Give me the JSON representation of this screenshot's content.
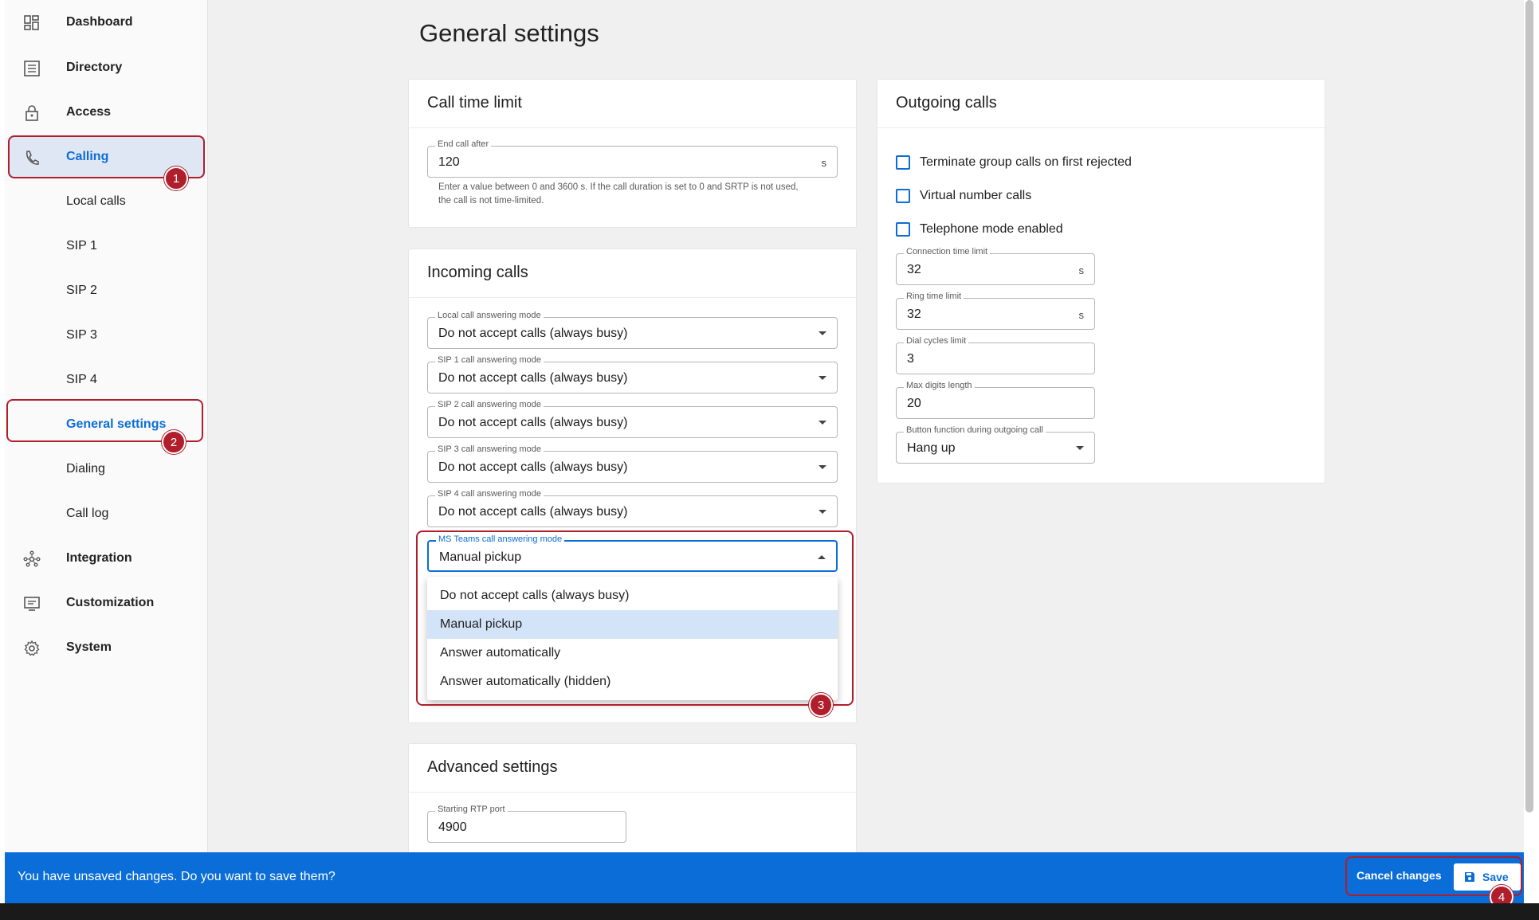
{
  "sidebar": {
    "items": [
      {
        "label": "Dashboard",
        "icon": "dashboard-icon"
      },
      {
        "label": "Directory",
        "icon": "directory-icon"
      },
      {
        "label": "Access",
        "icon": "lock-icon"
      },
      {
        "label": "Calling",
        "icon": "phone-icon"
      },
      {
        "label": "Local calls"
      },
      {
        "label": "SIP 1"
      },
      {
        "label": "SIP 2"
      },
      {
        "label": "SIP 3"
      },
      {
        "label": "SIP 4"
      },
      {
        "label": "General settings"
      },
      {
        "label": "Dialing"
      },
      {
        "label": "Call log"
      },
      {
        "label": "Integration",
        "icon": "integration-icon"
      },
      {
        "label": "Customization",
        "icon": "customization-icon"
      },
      {
        "label": "System",
        "icon": "gear-icon"
      }
    ]
  },
  "badges": [
    "1",
    "2",
    "3",
    "4"
  ],
  "page": {
    "title": "General settings"
  },
  "call_time_limit": {
    "title": "Call time limit",
    "end_call_label": "End call after",
    "end_call_value": "120",
    "unit": "s",
    "helper_line1": "Enter a value between 0 and 3600 s. If the call duration is set to 0 and SRTP is not used,",
    "helper_line2": "the call is not time-limited."
  },
  "incoming": {
    "title": "Incoming calls",
    "fields": [
      {
        "label": "Local call answering mode",
        "value": "Do not accept calls (always busy)"
      },
      {
        "label": "SIP 1 call answering mode",
        "value": "Do not accept calls (always busy)"
      },
      {
        "label": "SIP 2 call answering mode",
        "value": "Do not accept calls (always busy)"
      },
      {
        "label": "SIP 3 call answering mode",
        "value": "Do not accept calls (always busy)"
      },
      {
        "label": "SIP 4 call answering mode",
        "value": "Do not accept calls (always busy)"
      }
    ],
    "ms_teams": {
      "label": "MS Teams call answering mode",
      "value": "Manual pickup"
    },
    "options": [
      "Do not accept calls (always busy)",
      "Manual pickup",
      "Answer automatically",
      "Answer automatically (hidden)"
    ]
  },
  "advanced": {
    "title": "Advanced settings",
    "rtp_label": "Starting RTP port",
    "rtp_value": "4900"
  },
  "outgoing": {
    "title": "Outgoing calls",
    "checkboxes": [
      "Terminate group calls on first rejected",
      "Virtual number calls",
      "Telephone mode enabled"
    ],
    "connection_label": "Connection time limit",
    "connection_value": "32",
    "ring_label": "Ring time limit",
    "ring_value": "32",
    "unit": "s",
    "dial_label": "Dial cycles limit",
    "dial_value": "3",
    "digits_label": "Max digits length",
    "digits_value": "20",
    "button_label": "Button function during outgoing call",
    "button_value": "Hang up"
  },
  "savebar": {
    "message": "You have unsaved changes. Do you want to save them?",
    "cancel": "Cancel changes",
    "save": "Save"
  },
  "colors": {
    "accent": "#0b6ed8",
    "callout": "#b01e2c"
  }
}
